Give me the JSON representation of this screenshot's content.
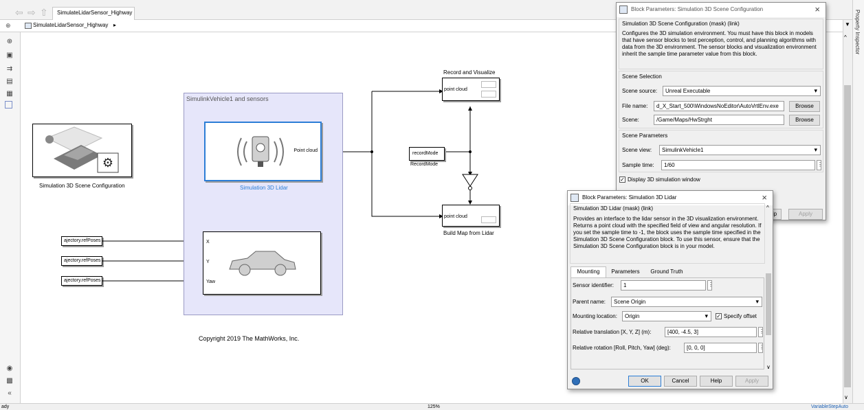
{
  "window": {
    "tab_label": "SimulateLidarSensor_Highway",
    "breadcrumb": "SimulateLidarSensor_Highway"
  },
  "canvas": {
    "scene_config_label": "Simulation 3D Scene Configuration",
    "subsystem_title": "SimulinkVehicle1 and sensors",
    "lidar_port": "Point cloud",
    "lidar_label": "Simulation 3D Lidar",
    "traj_inputs": [
      "ajectory.refPoses",
      "ajectory.refPoses",
      "ajectory.refPoses"
    ],
    "vehicle_ports": [
      "X",
      "Y",
      "Yaw"
    ],
    "record_block_title": "Record and Visualize",
    "record_port": "point cloud",
    "record_mode_block": "recordMode",
    "record_mode_label": "RecordMode",
    "build_port": "point cloud",
    "build_label": "Build Map from Lidar",
    "copyright": "Copyright 2019 The MathWorks, Inc."
  },
  "side": {
    "property_inspector": "Property Inspector"
  },
  "status": {
    "left": "ady",
    "zoom": "125%",
    "solver": "VariableStepAuto"
  },
  "scene_dialog": {
    "title": "Block Parameters: Simulation 3D Scene Configuration",
    "header": "Simulation 3D Scene Configuration (mask) (link)",
    "description": "Configures the 3D simulation environment. You must have this block in models that have sensor blocks to test perception, control, and planning algorithms with data from the 3D environment. The sensor blocks and visualization environment inherit the sample time parameter value from this block.",
    "scene_selection": "Scene Selection",
    "scene_source_label": "Scene source:",
    "scene_source_value": "Unreal Executable",
    "file_name_label": "File name:",
    "file_name_value": "d_X_Start_500\\WindowsNoEditor\\AutoVrtlEnv.exe",
    "browse1": "Browse",
    "scene_label": "Scene:",
    "scene_value": "/Game/Maps/HwStrght",
    "browse2": "Browse",
    "scene_parameters": "Scene Parameters",
    "scene_view_label": "Scene view:",
    "scene_view_value": "SimulinkVehicle1",
    "sample_time_label": "Sample time:",
    "sample_time_value": "1/60",
    "display_window": "Display 3D simulation window",
    "help_partial": "lp",
    "apply": "Apply"
  },
  "lidar_dialog": {
    "title": "Block Parameters: Simulation 3D Lidar",
    "header": "Simulation 3D Lidar (mask) (link)",
    "description": "Provides an interface to the lidar sensor in the 3D visualization environment. Returns a point cloud with the specified field of view and angular resolution. If you set the sample time to -1, the block uses the sample time specified in the Simulation 3D Scene Configuration block. To use this sensor, ensure that the Simulation 3D Scene Configuration block is in your model.",
    "tabs": [
      "Mounting",
      "Parameters",
      "Ground Truth"
    ],
    "sensor_id_label": "Sensor identifier:",
    "sensor_id_value": "1",
    "parent_name_label": "Parent name:",
    "parent_name_value": "Scene Origin",
    "mounting_location_label": "Mounting location:",
    "mounting_location_value": "Origin",
    "specify_offset": "Specify offset",
    "rel_translation_label": "Relative translation [X, Y, Z] (m):",
    "rel_translation_value": "[400, -4.5, 3]",
    "rel_rotation_label": "Relative rotation [Roll, Pitch, Yaw] (deg):",
    "rel_rotation_value": "[0, 0, 0]",
    "ok": "OK",
    "cancel": "Cancel",
    "help": "Help",
    "apply": "Apply"
  }
}
